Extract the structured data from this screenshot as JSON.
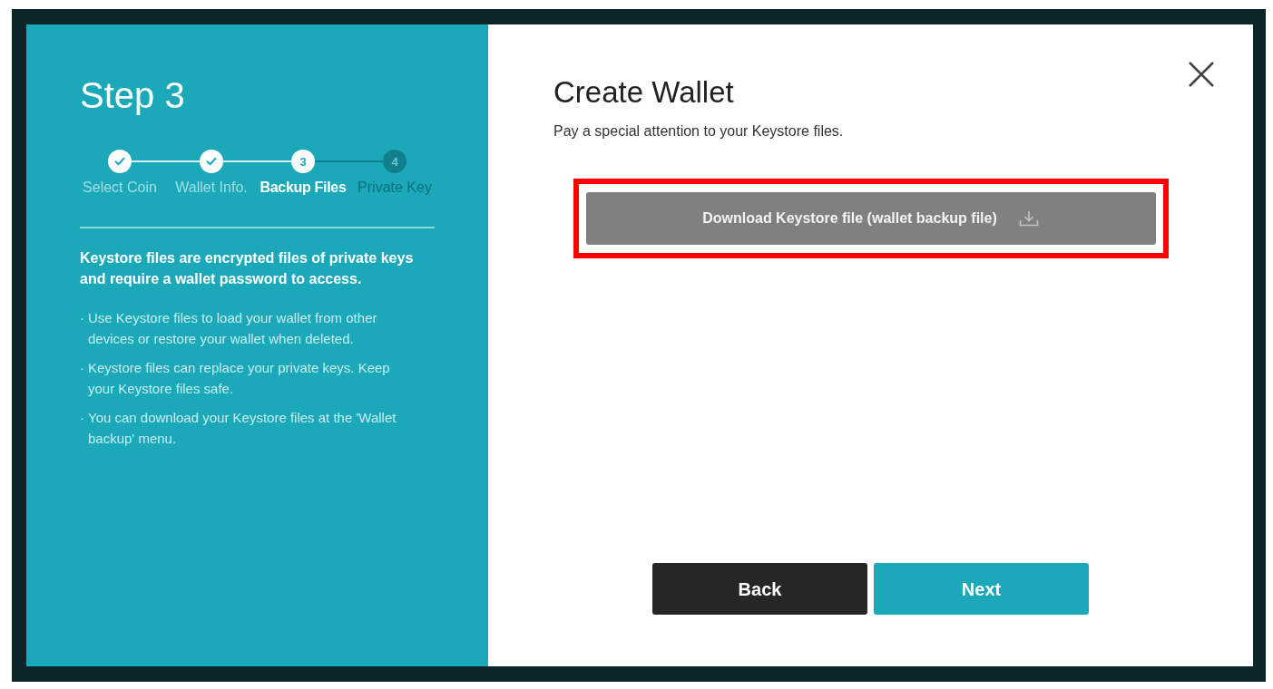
{
  "sidebar": {
    "title": "Step 3",
    "steps": [
      {
        "label": "Select Coin",
        "kind": "done"
      },
      {
        "label": "Wallet Info.",
        "kind": "done"
      },
      {
        "label": "Backup Files",
        "kind": "current",
        "number": "3"
      },
      {
        "label": "Private Key",
        "kind": "upcoming",
        "number": "4"
      }
    ],
    "intro": "Keystore files are encrypted files of private keys and require a wallet password to access.",
    "notes": [
      {
        "marker": "·",
        "text": "Use Keystore files to load your wallet from other devices or restore your wallet when deleted."
      },
      {
        "marker": "·",
        "text": "Keystore files can replace your private keys. Keep your Keystore files safe."
      },
      {
        "marker": "·",
        "text": "You can download your Keystore files at the 'Wallet backup' menu."
      }
    ]
  },
  "main": {
    "title": "Create Wallet",
    "subtitle": "Pay a special attention to your Keystore files.",
    "download_button": {
      "label": "Download Keystore file (wallet backup file)",
      "highlighted": true
    },
    "buttons": [
      {
        "label": "Back",
        "kind": "secondary"
      },
      {
        "label": "Next",
        "kind": "primary"
      }
    ]
  }
}
